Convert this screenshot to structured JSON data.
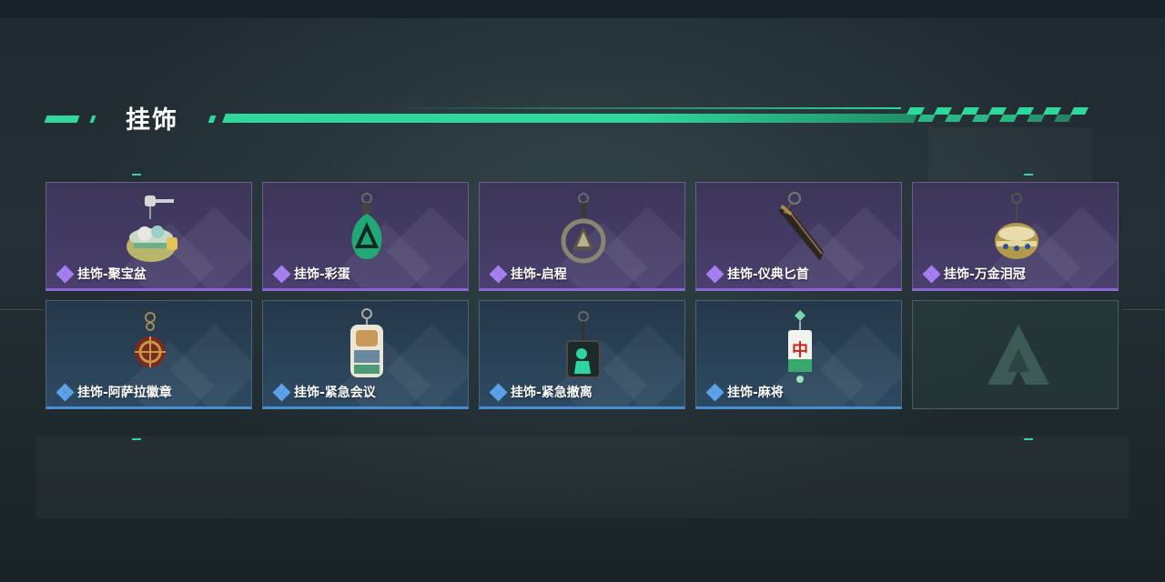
{
  "section": {
    "title": "挂饰"
  },
  "colors": {
    "accent": "#2fd89a",
    "rarity_purple": "#8a66d6",
    "rarity_blue": "#4a8fd2"
  },
  "items": [
    {
      "label": "挂饰-聚宝盆",
      "rarity": "purple",
      "icon": "treasure-bowl-charm-icon"
    },
    {
      "label": "挂饰-彩蛋",
      "rarity": "purple",
      "icon": "easter-egg-charm-icon"
    },
    {
      "label": "挂饰-启程",
      "rarity": "purple",
      "icon": "departure-emblem-charm-icon"
    },
    {
      "label": "挂饰-仪典匕首",
      "rarity": "purple",
      "icon": "ceremonial-dagger-charm-icon"
    },
    {
      "label": "挂饰-万金泪冠",
      "rarity": "purple",
      "icon": "golden-crown-charm-icon"
    },
    {
      "label": "挂饰-阿萨拉徽章",
      "rarity": "blue",
      "icon": "ahsarah-badge-charm-icon"
    },
    {
      "label": "挂饰-紧急会议",
      "rarity": "blue",
      "icon": "emergency-meeting-charm-icon"
    },
    {
      "label": "挂饰-紧急撤离",
      "rarity": "blue",
      "icon": "emergency-evacuation-charm-icon"
    },
    {
      "label": "挂饰-麻将",
      "rarity": "blue",
      "icon": "mahjong-tile-charm-icon"
    }
  ],
  "empty_slot": {
    "icon": "game-logo-icon"
  }
}
